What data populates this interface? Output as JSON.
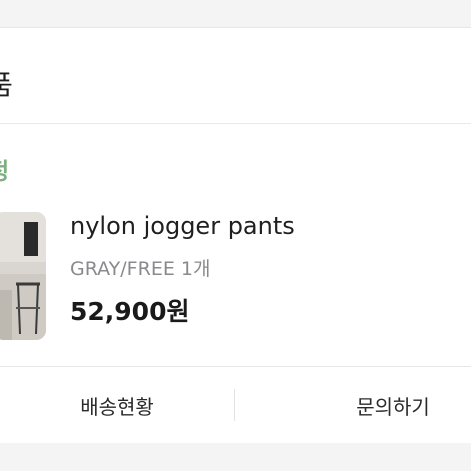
{
  "section": {
    "header_text": "품"
  },
  "order": {
    "status": "정",
    "product": {
      "name": "nylon jogger pants",
      "option": "GRAY/FREE 1개",
      "price": "52,900원"
    }
  },
  "actions": {
    "delivery_status_label": "배송현황",
    "inquiry_label": "문의하기"
  },
  "colors": {
    "status_green": "#7db07f",
    "band_gray": "#f4f4f5",
    "option_gray": "#8a8a8e"
  }
}
